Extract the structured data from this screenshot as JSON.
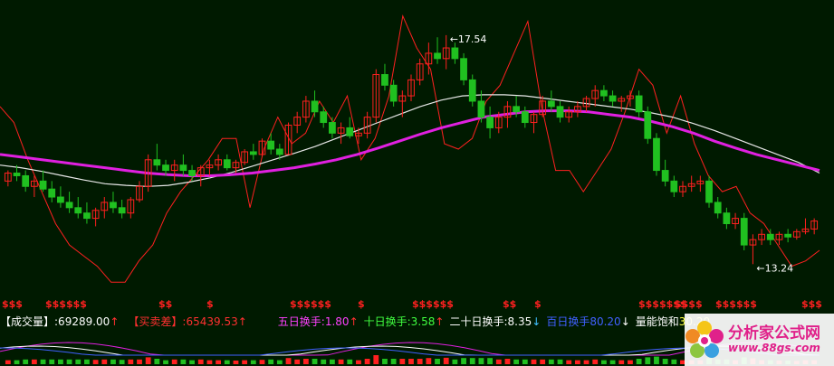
{
  "chart_data": {
    "type": "candlestick",
    "price_annotations": {
      "high_label": "17.54",
      "low_label": "13.24",
      "arrow_label": "←"
    },
    "candles": [
      [
        14.8,
        15.0,
        14.7,
        14.95
      ],
      [
        14.95,
        15.1,
        14.8,
        14.9
      ],
      [
        14.9,
        15.0,
        14.6,
        14.7
      ],
      [
        14.7,
        14.9,
        14.5,
        14.8
      ],
      [
        14.8,
        15.0,
        14.6,
        14.65
      ],
      [
        14.65,
        14.8,
        14.4,
        14.5
      ],
      [
        14.5,
        14.7,
        14.3,
        14.4
      ],
      [
        14.4,
        14.6,
        14.2,
        14.3
      ],
      [
        14.3,
        14.5,
        14.1,
        14.2
      ],
      [
        14.2,
        14.4,
        14.0,
        14.1
      ],
      [
        14.1,
        14.3,
        13.95,
        14.25
      ],
      [
        14.25,
        14.5,
        14.1,
        14.4
      ],
      [
        14.4,
        14.6,
        14.2,
        14.3
      ],
      [
        14.3,
        14.45,
        14.1,
        14.2
      ],
      [
        14.2,
        14.5,
        14.1,
        14.45
      ],
      [
        14.45,
        14.8,
        14.4,
        14.7
      ],
      [
        14.7,
        15.3,
        14.6,
        15.2
      ],
      [
        15.2,
        15.5,
        15.0,
        15.1
      ],
      [
        15.1,
        15.2,
        14.9,
        15.0
      ],
      [
        15.0,
        15.2,
        14.8,
        15.1
      ],
      [
        15.1,
        15.3,
        14.9,
        15.0
      ],
      [
        15.0,
        15.1,
        14.8,
        14.9
      ],
      [
        14.9,
        15.1,
        14.7,
        15.05
      ],
      [
        15.05,
        15.2,
        14.9,
        15.1
      ],
      [
        15.1,
        15.3,
        15.0,
        15.2
      ],
      [
        15.2,
        15.3,
        15.0,
        15.05
      ],
      [
        15.05,
        15.2,
        14.95,
        15.15
      ],
      [
        15.15,
        15.4,
        15.1,
        15.35
      ],
      [
        15.35,
        15.5,
        15.2,
        15.3
      ],
      [
        15.3,
        15.6,
        15.25,
        15.55
      ],
      [
        15.55,
        15.7,
        15.3,
        15.4
      ],
      [
        15.4,
        15.5,
        15.2,
        15.3
      ],
      [
        15.3,
        15.9,
        15.3,
        15.85
      ],
      [
        15.85,
        16.1,
        15.7,
        16.0
      ],
      [
        16.0,
        16.4,
        15.9,
        16.3
      ],
      [
        16.3,
        16.5,
        16.0,
        16.1
      ],
      [
        16.1,
        16.2,
        15.8,
        15.9
      ],
      [
        15.9,
        16.0,
        15.6,
        15.7
      ],
      [
        15.7,
        15.9,
        15.5,
        15.8
      ],
      [
        15.8,
        16.0,
        15.6,
        15.65
      ],
      [
        15.65,
        15.8,
        15.5,
        15.7
      ],
      [
        15.7,
        16.1,
        15.6,
        16.0
      ],
      [
        16.0,
        16.9,
        15.9,
        16.8
      ],
      [
        16.8,
        17.0,
        16.5,
        16.6
      ],
      [
        16.6,
        16.7,
        16.2,
        16.3
      ],
      [
        16.3,
        16.5,
        16.0,
        16.4
      ],
      [
        16.4,
        16.8,
        16.3,
        16.7
      ],
      [
        16.7,
        17.1,
        16.6,
        17.0
      ],
      [
        17.0,
        17.4,
        16.8,
        17.2
      ],
      [
        17.2,
        17.5,
        17.0,
        17.1
      ],
      [
        17.1,
        17.54,
        16.9,
        17.3
      ],
      [
        17.3,
        17.4,
        17.0,
        17.1
      ],
      [
        17.1,
        17.2,
        16.6,
        16.7
      ],
      [
        16.7,
        16.8,
        16.2,
        16.3
      ],
      [
        16.3,
        16.5,
        15.9,
        16.0
      ],
      [
        16.0,
        16.2,
        15.6,
        15.8
      ],
      [
        15.8,
        16.1,
        15.7,
        16.0
      ],
      [
        16.0,
        16.3,
        15.8,
        16.2
      ],
      [
        16.2,
        16.4,
        16.0,
        16.1
      ],
      [
        16.1,
        16.2,
        15.8,
        15.9
      ],
      [
        15.9,
        16.1,
        15.7,
        16.05
      ],
      [
        16.05,
        16.4,
        16.0,
        16.3
      ],
      [
        16.3,
        16.5,
        16.1,
        16.2
      ],
      [
        16.2,
        16.3,
        15.9,
        16.0
      ],
      [
        16.0,
        16.2,
        15.9,
        16.1
      ],
      [
        16.1,
        16.3,
        16.0,
        16.2
      ],
      [
        16.2,
        16.4,
        16.1,
        16.35
      ],
      [
        16.35,
        16.6,
        16.2,
        16.5
      ],
      [
        16.5,
        16.6,
        16.3,
        16.4
      ],
      [
        16.4,
        16.5,
        16.2,
        16.3
      ],
      [
        16.3,
        16.4,
        16.1,
        16.35
      ],
      [
        16.35,
        16.5,
        16.2,
        16.4
      ],
      [
        16.4,
        16.5,
        16.0,
        16.1
      ],
      [
        16.1,
        16.2,
        15.5,
        15.6
      ],
      [
        15.6,
        15.7,
        14.9,
        15.0
      ],
      [
        15.0,
        15.2,
        14.7,
        14.8
      ],
      [
        14.8,
        14.9,
        14.5,
        14.6
      ],
      [
        14.6,
        14.8,
        14.5,
        14.7
      ],
      [
        14.7,
        14.9,
        14.6,
        14.75
      ],
      [
        14.75,
        14.9,
        14.6,
        14.8
      ],
      [
        14.8,
        14.9,
        14.3,
        14.4
      ],
      [
        14.4,
        14.5,
        14.1,
        14.2
      ],
      [
        14.2,
        14.3,
        13.9,
        14.0
      ],
      [
        14.0,
        14.2,
        13.9,
        14.1
      ],
      [
        14.1,
        14.2,
        13.5,
        13.6
      ],
      [
        13.6,
        13.8,
        13.24,
        13.7
      ],
      [
        13.7,
        13.9,
        13.6,
        13.8
      ],
      [
        13.8,
        13.9,
        13.6,
        13.7
      ],
      [
        13.7,
        13.85,
        13.6,
        13.8
      ],
      [
        13.8,
        13.9,
        13.65,
        13.75
      ],
      [
        13.75,
        13.9,
        13.7,
        13.85
      ],
      [
        13.85,
        14.1,
        13.8,
        13.9
      ],
      [
        13.9,
        14.1,
        13.8,
        14.05
      ]
    ],
    "ma_long": [
      15.3,
      15.25,
      15.2,
      15.15,
      15.1,
      15.05,
      15.0,
      14.95,
      14.92,
      14.9,
      14.9,
      14.92,
      14.95,
      15.0,
      15.05,
      15.12,
      15.2,
      15.3,
      15.42,
      15.55,
      15.68,
      15.8,
      15.9,
      16.0,
      16.05,
      16.1,
      16.12,
      16.12,
      16.1,
      16.05,
      16.0,
      15.92,
      15.82,
      15.7,
      15.55,
      15.42,
      15.3,
      15.2,
      15.1,
      15.0
    ],
    "ma_mid": [
      15.1,
      15.05,
      14.98,
      14.9,
      14.82,
      14.75,
      14.72,
      14.7,
      14.72,
      14.78,
      14.86,
      14.96,
      15.08,
      15.2,
      15.32,
      15.45,
      15.6,
      15.75,
      15.9,
      16.05,
      16.2,
      16.32,
      16.4,
      16.42,
      16.42,
      16.4,
      16.35,
      16.3,
      16.25,
      16.2,
      16.15,
      16.08,
      16.0,
      15.88,
      15.75,
      15.6,
      15.45,
      15.3,
      15.15,
      14.95
    ],
    "volatility_line": [
      16.2,
      15.9,
      15.2,
      14.6,
      14.0,
      13.6,
      13.4,
      13.2,
      12.9,
      12.9,
      13.3,
      13.6,
      14.2,
      14.6,
      14.9,
      15.2,
      15.6,
      15.6,
      14.3,
      15.4,
      16.0,
      15.5,
      15.7,
      16.3,
      15.9,
      16.4,
      15.2,
      15.6,
      16.4,
      17.9,
      17.3,
      16.9,
      15.5,
      15.4,
      15.6,
      16.3,
      16.6,
      17.2,
      17.8,
      16.2,
      15.0,
      15.0,
      14.6,
      15.0,
      15.4,
      16.1,
      16.9,
      16.6,
      15.7,
      16.4,
      15.5,
      14.9,
      14.6,
      14.7,
      14.2,
      14.0,
      13.6,
      13.2,
      13.3,
      13.5
    ]
  },
  "indicators": {
    "volume": {
      "label": "【成交量】",
      "value": ":69289.00",
      "arrow": "↑"
    },
    "buy_sell": {
      "label": "【买卖差】",
      "value": ":65439.53",
      "arrow": "↑"
    },
    "turnover5": {
      "label": "五日换手",
      "value": ":1.80",
      "arrow": "↑"
    },
    "turnover10": {
      "label": "十日换手",
      "value": ":3.58",
      "arrow": "↑"
    },
    "turnover20": {
      "label": "二十日换手",
      "value": ":8.35",
      "arrow": "↓"
    },
    "turnover100": {
      "label": "百日换手",
      "value": "80.20",
      "arrow": "↓"
    },
    "saturation": {
      "label": "量能饱和",
      "value": "30.20",
      "arrow": ""
    }
  },
  "signal_marks": {
    "symbol": "$",
    "groups": [
      "$$$",
      "$$$$$$",
      "$$",
      "$",
      "$$$$$$",
      "$",
      "$$$$$$",
      "$$",
      "$",
      "$$$$$$$",
      "$$$$",
      "$$$$$$",
      "$$$"
    ]
  },
  "logo": {
    "name": "分析家公式网",
    "url": "www.88gs.com"
  },
  "colors": {
    "background": "#001a00",
    "up": "#ff2020",
    "down": "#20c020",
    "ma_long": "#e020e0",
    "ma_mid": "#e8e8e8",
    "volatility": "#ff2020",
    "label_red": "#ff3030",
    "label_white": "#ffffff",
    "label_magenta": "#ff40ff",
    "label_green": "#40ff40",
    "label_blue": "#4060ff",
    "logo": "#e0218a"
  }
}
